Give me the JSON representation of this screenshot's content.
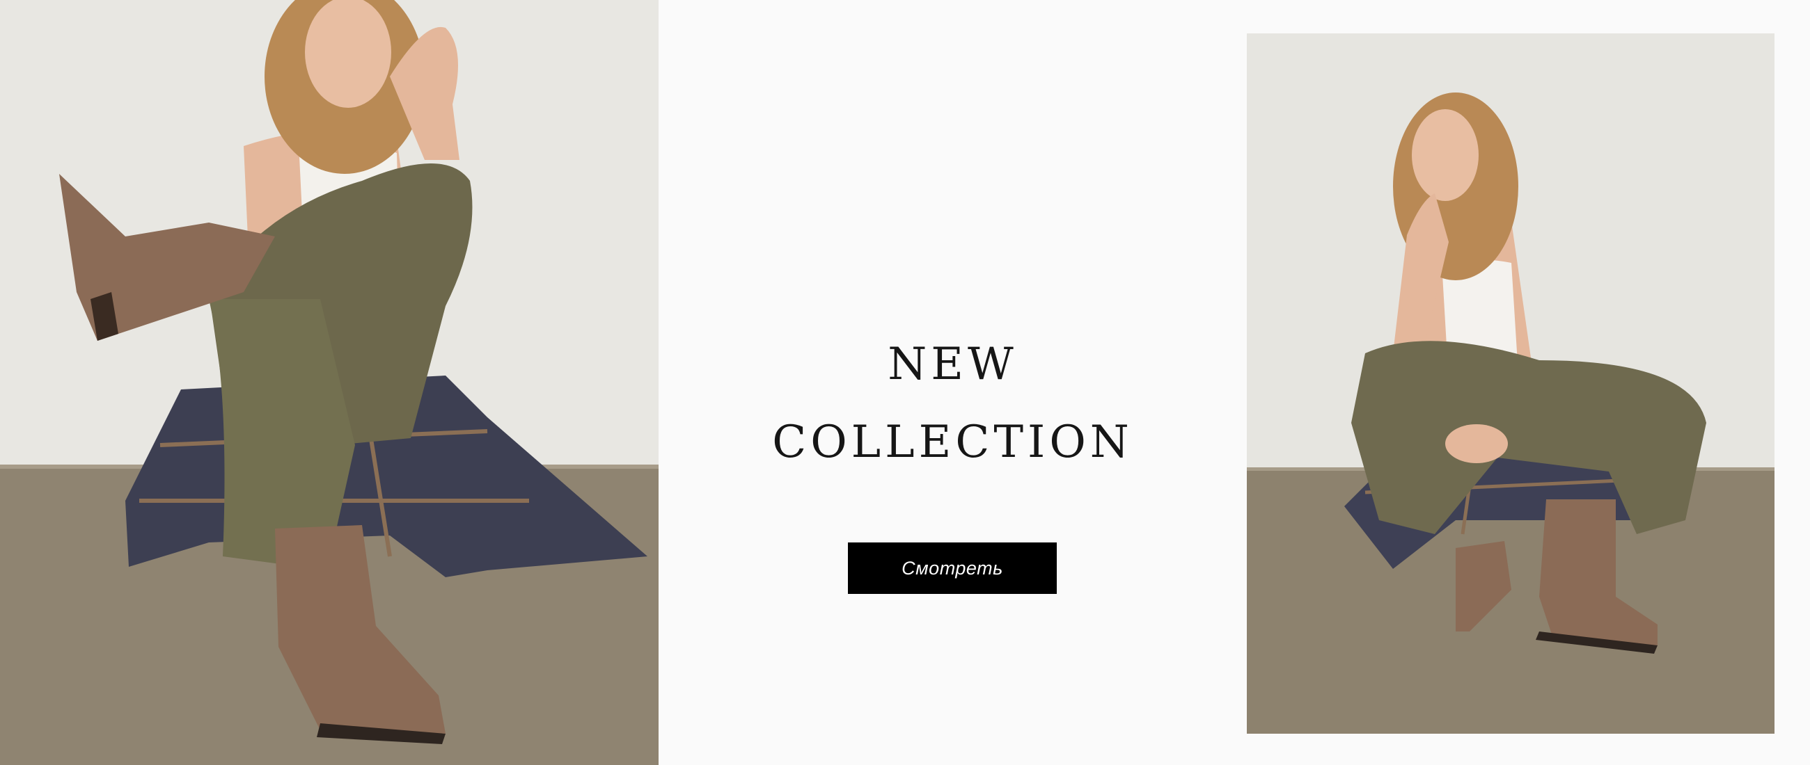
{
  "hero": {
    "headline_line1": "NEW",
    "headline_line2": "COLLECTION",
    "cta_label": "Смотреть"
  },
  "colors": {
    "background": "#fafafa",
    "cta_background": "#000000",
    "cta_text": "#ffffff",
    "headline": "#161616"
  },
  "images": {
    "left": "model-sitting-boot-raised-photo",
    "right": "model-crouching-chin-on-hand-photo"
  }
}
